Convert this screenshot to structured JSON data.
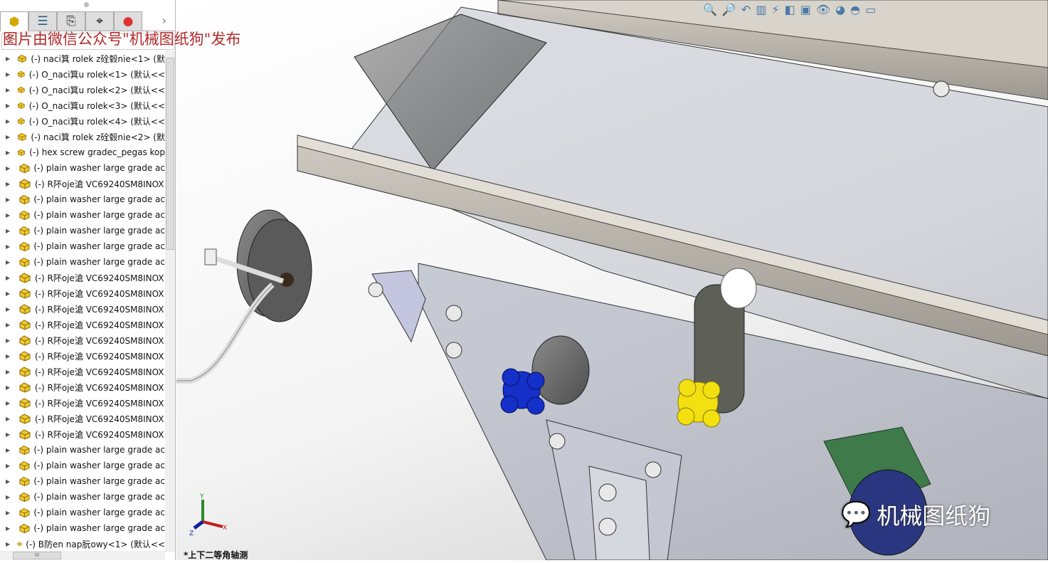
{
  "watermark_top": "图片由微信公众号\"机械图纸狗\"发布",
  "watermark_bottom": "机械图纸狗",
  "view_orientation": "*上下二等角轴测",
  "panel_tabs": [
    "feature-manager",
    "property-manager",
    "configuration-manager",
    "dimxpert-manager",
    "display-manager"
  ],
  "toolbar_icons": [
    "zoom-to-fit-icon",
    "zoom-to-area-icon",
    "previous-view-icon",
    "section-view-icon",
    "dynamic-annotation-icon",
    "view-orientation-icon",
    "display-style-icon",
    "hide-show-icon",
    "edit-appearance-icon",
    "apply-scene-icon",
    "view-settings-icon"
  ],
  "triad": {
    "x": "X",
    "y": "Y",
    "z": "Z"
  },
  "tree_items": [
    "(-) naci箕 rolek z硂毂nie<1> (默",
    "(-) O_naci箕u rolek<1> (默认<<",
    "(-) O_naci箕u rolek<2> (默认<<",
    "(-) O_naci箕u rolek<3> (默认<<",
    "(-) O_naci箕u rolek<4> (默认<<",
    "(-) naci箕 rolek z硂毂nie<2> (默",
    "(-) hex screw gradec_pegas kop",
    "(-) plain washer large grade ac",
    "(-) R阫oje滄 VC69240SM8INOX",
    "(-) plain washer large grade ac",
    "(-) plain washer large grade ac",
    "(-) plain washer large grade ac",
    "(-) plain washer large grade ac",
    "(-) plain washer large grade ac",
    "(-) R阫oje滄 VC69240SM8INOX",
    "(-) R阫oje滄 VC69240SM8INOX",
    "(-) R阫oje滄 VC69240SM8INOX",
    "(-) R阫oje滄 VC69240SM8INOX",
    "(-) R阫oje滄 VC69240SM8INOX",
    "(-) R阫oje滄 VC69240SM8INOX",
    "(-) R阫oje滄 VC69240SM8INOX",
    "(-) R阫oje滄 VC69240SM8INOX",
    "(-) R阫oje滄 VC69240SM8INOX",
    "(-) R阫oje滄 VC69240SM8INOX",
    "(-) R阫oje滄 VC69240SM8INOX",
    "(-) plain washer large grade ac",
    "(-) plain washer large grade ac",
    "(-) plain washer large grade ac",
    "(-) plain washer large grade ac",
    "(-) plain washer large grade ac",
    "(-) plain washer large grade ac",
    "(-) B防en nap朊owy<1> (默认<<"
  ],
  "colors": {
    "knob_blue": "#1430c8",
    "knob_yellow": "#f2e010",
    "frame_gray": "#a8a49c",
    "caster_green": "#3f7a4a"
  }
}
